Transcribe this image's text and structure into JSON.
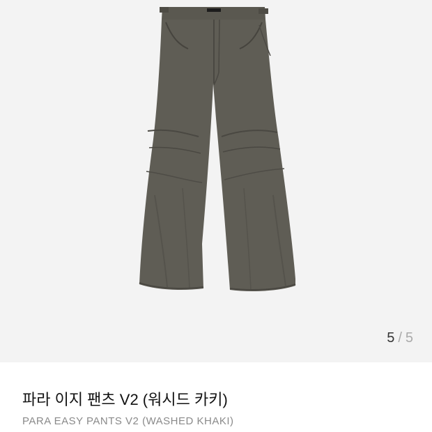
{
  "gallery": {
    "counter_current": "5",
    "counter_separator": "/",
    "counter_total": "5"
  },
  "product": {
    "title": "파라 이지 팬츠 V2 (워시드 카키)",
    "subtitle": "PARA EASY PANTS V2 (WASHED KHAKI)",
    "garment_color": "#5c5a52"
  }
}
